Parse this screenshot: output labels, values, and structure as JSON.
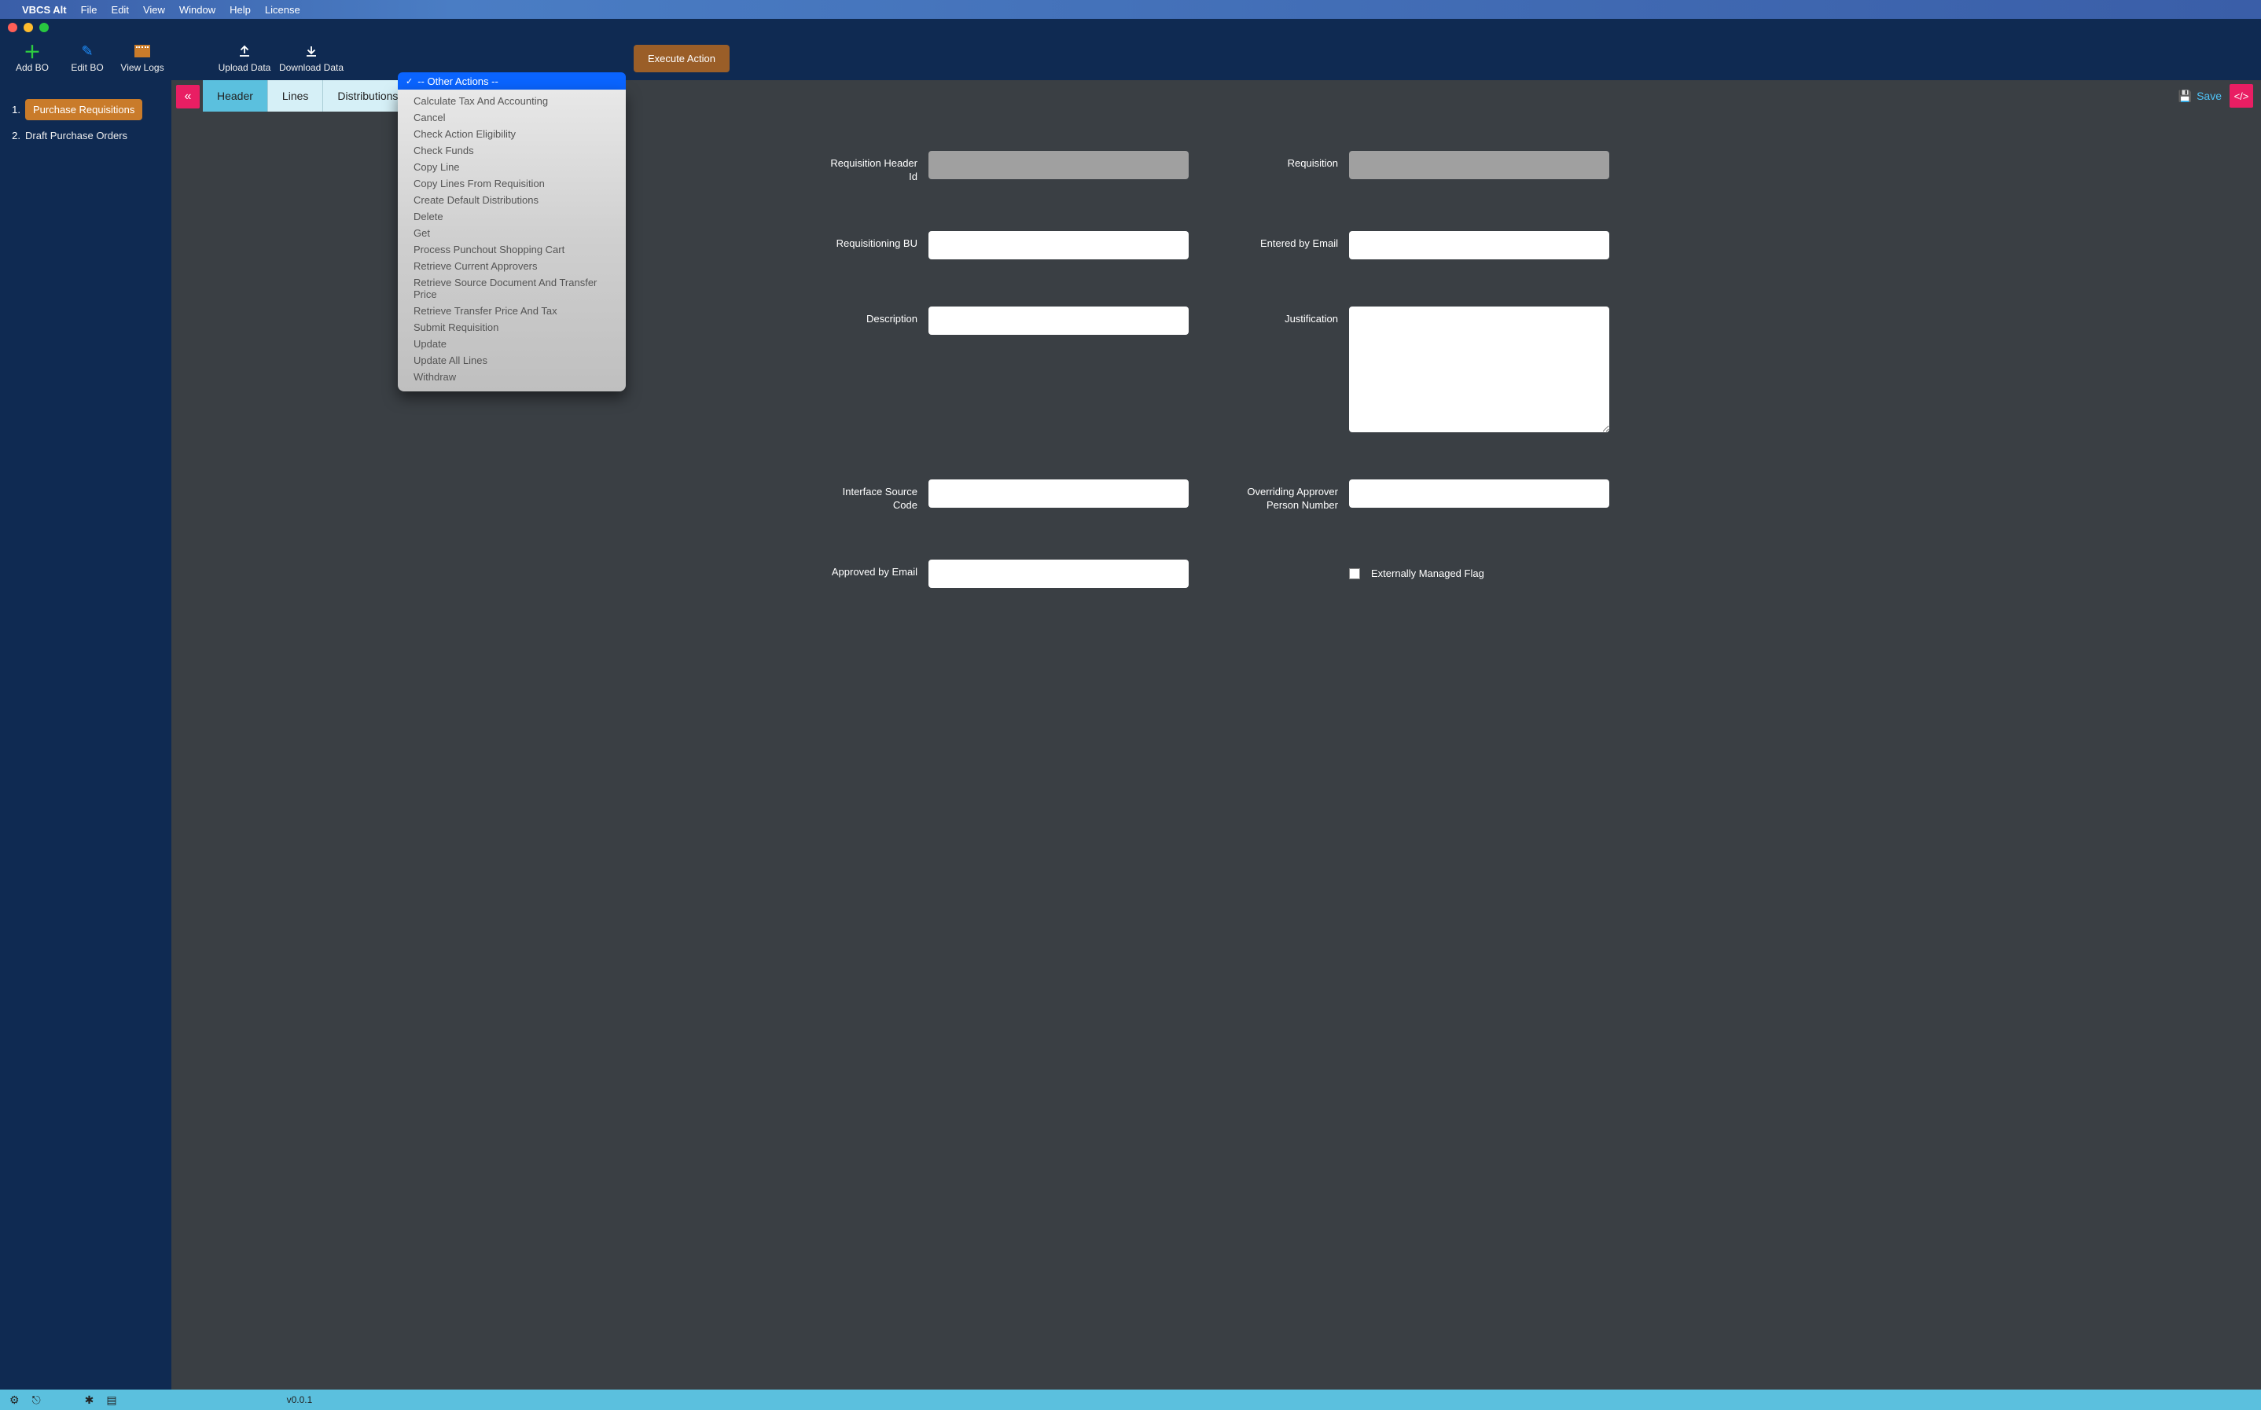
{
  "menubar": {
    "appname": "VBCS Alt",
    "items": [
      "File",
      "Edit",
      "View",
      "Window",
      "Help",
      "License"
    ]
  },
  "toolbar": {
    "addbo": "Add BO",
    "editbo": "Edit BO",
    "viewlogs": "View Logs",
    "upload": "Upload Data",
    "download": "Download Data",
    "execute": "Execute Action"
  },
  "actions_dropdown": {
    "selected": "-- Other Actions --",
    "options": [
      "Calculate Tax And Accounting",
      "Cancel",
      "Check Action Eligibility",
      "Check Funds",
      "Copy Line",
      "Copy Lines From Requisition",
      "Create Default Distributions",
      "Delete",
      "Get",
      "Process Punchout Shopping Cart",
      "Retrieve Current Approvers",
      "Retrieve Source Document And Transfer Price",
      "Retrieve Transfer Price And Tax",
      "Submit Requisition",
      "Update",
      "Update All Lines",
      "Withdraw"
    ]
  },
  "sidebar": {
    "items": [
      {
        "num": "1.",
        "label": "Purchase Requisitions",
        "active": true
      },
      {
        "num": "2.",
        "label": "Draft Purchase Orders",
        "active": false
      }
    ]
  },
  "tabs": {
    "items": [
      "Header",
      "Lines",
      "Distributions"
    ],
    "active": "Header",
    "save": "Save"
  },
  "form": {
    "requisition_header_id": {
      "label": "Requisition Header Id",
      "value": ""
    },
    "requisition": {
      "label": "Requisition",
      "value": ""
    },
    "requisitioning_bu": {
      "label": "Requisitioning BU",
      "value": ""
    },
    "entered_by_email": {
      "label": "Entered by Email",
      "value": ""
    },
    "description": {
      "label": "Description",
      "value": ""
    },
    "justification": {
      "label": "Justification",
      "value": ""
    },
    "interface_source_code": {
      "label": "Interface Source Code",
      "value": ""
    },
    "overriding_approver": {
      "label": "Overriding Approver Person Number",
      "value": ""
    },
    "approved_by_email": {
      "label": "Approved by Email",
      "value": ""
    },
    "externally_managed": {
      "label": "Externally Managed Flag",
      "checked": false
    }
  },
  "statusbar": {
    "version": "v0.0.1"
  }
}
